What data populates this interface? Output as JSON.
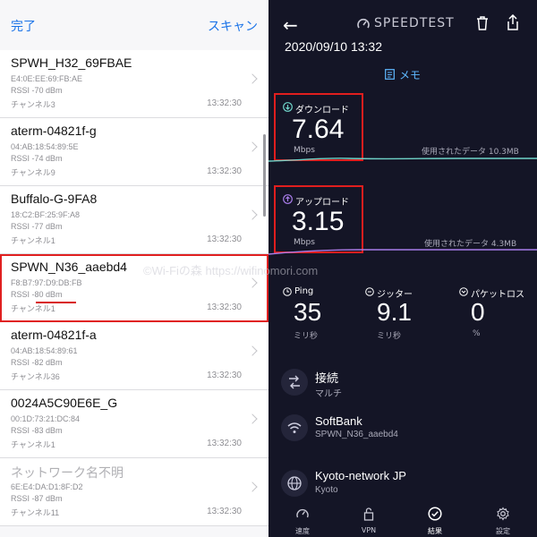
{
  "left": {
    "done_label": "完了",
    "scan_label": "スキャン",
    "networks": [
      {
        "ssid": "SPWH_H32_69FBAE",
        "mac": "E4:0E:EE:69:FB:AE",
        "rssi": "RSSI -70 dBm",
        "channel": "チャンネル3",
        "time": "13:32:30"
      },
      {
        "ssid": "aterm-04821f-g",
        "mac": "04:AB:18:54:89:5E",
        "rssi": "RSSI -74 dBm",
        "channel": "チャンネル9",
        "time": "13:32:30"
      },
      {
        "ssid": "Buffalo-G-9FA8",
        "mac": "18:C2:BF:25:9F:A8",
        "rssi": "RSSI -77 dBm",
        "channel": "チャンネル1",
        "time": "13:32:30"
      },
      {
        "ssid": "SPWN_N36_aaebd4",
        "mac": "F8:B7:97:D9:DB:FB",
        "rssi": "RSSI -80 dBm",
        "channel": "チャンネル1",
        "time": "13:32:30"
      },
      {
        "ssid": "aterm-04821f-a",
        "mac": "04:AB:18:54:89:61",
        "rssi": "RSSI -82 dBm",
        "channel": "チャンネル36",
        "time": "13:32:30"
      },
      {
        "ssid": "0024A5C90E6E_G",
        "mac": "00:1D:73:21:DC:84",
        "rssi": "RSSI -83 dBm",
        "channel": "チャンネル1",
        "time": "13:32:30"
      },
      {
        "ssid": "ネットワーク名不明",
        "mac": "6E:E4:DA:D1:8F:D2",
        "rssi": "RSSI -87 dBm",
        "channel": "チャンネル11",
        "time": "13:32:30"
      }
    ]
  },
  "right": {
    "brand": "SPEEDTEST",
    "datetime": "2020/09/10 13:32",
    "memo_label": "メモ",
    "download": {
      "label": "ダウンロード",
      "value": "7.64",
      "unit": "Mbps",
      "used": "使用されたデータ 10.3MB"
    },
    "upload": {
      "label": "アップロード",
      "value": "3.15",
      "unit": "Mbps",
      "used": "使用されたデータ 4.3MB"
    },
    "ping": {
      "label": "Ping",
      "value": "35",
      "unit": "ミリ秒"
    },
    "jitter": {
      "label": "ジッター",
      "value": "9.1",
      "unit": "ミリ秒"
    },
    "loss": {
      "label": "パケットロス",
      "value": "0",
      "unit": "%"
    },
    "connection": {
      "title": "接続",
      "sub": "マルチ"
    },
    "carrier": {
      "title": "SoftBank",
      "sub": "SPWN_N36_aaebd4"
    },
    "server": {
      "title": "Kyoto-network JP",
      "sub": "Kyoto"
    },
    "tabs": [
      "速度",
      "VPN",
      "結果",
      "設定"
    ]
  },
  "watermark": "©Wi-Fiの森  https://wifinomori.com",
  "colors": {
    "accent_blue": "#1a73e8",
    "speedtest_bg": "#141526",
    "highlight_red": "#e01e1e",
    "download_teal": "#6fd3c8",
    "upload_purple": "#a77ce8"
  }
}
